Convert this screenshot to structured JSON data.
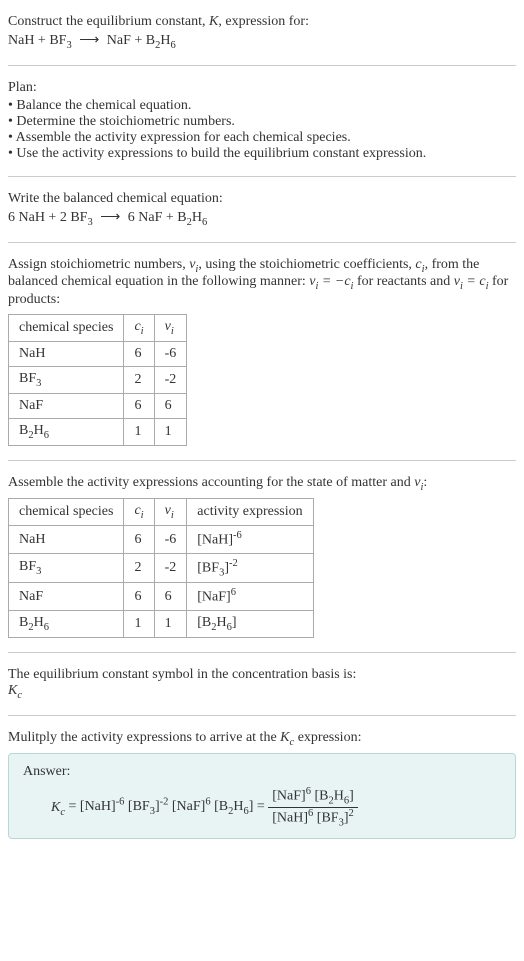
{
  "intro": {
    "line1": "Construct the equilibrium constant, ",
    "K": "K",
    "line1b": ", expression for:",
    "equation": "NaH + BF₃  ⟶  NaF + B₂H₆"
  },
  "plan": {
    "title": "Plan:",
    "items": [
      "• Balance the chemical equation.",
      "• Determine the stoichiometric numbers.",
      "• Assemble the activity expression for each chemical species.",
      "• Use the activity expressions to build the equilibrium constant expression."
    ]
  },
  "balanced": {
    "title": "Write the balanced chemical equation:",
    "equation": "6 NaH + 2 BF₃  ⟶  6 NaF + B₂H₆"
  },
  "stoich": {
    "text1": "Assign stoichiometric numbers, ",
    "nu_i": "νᵢ",
    "text2": ", using the stoichiometric coefficients, ",
    "c_i": "cᵢ",
    "text3": ", from the balanced chemical equation in the following manner: ",
    "eq1": "νᵢ = −cᵢ",
    "text4": " for reactants and ",
    "eq2": "νᵢ = cᵢ",
    "text5": " for products:",
    "headers": [
      "chemical species",
      "cᵢ",
      "νᵢ"
    ],
    "rows": [
      [
        "NaH",
        "6",
        "-6"
      ],
      [
        "BF₃",
        "2",
        "-2"
      ],
      [
        "NaF",
        "6",
        "6"
      ],
      [
        "B₂H₆",
        "1",
        "1"
      ]
    ]
  },
  "activity": {
    "text1": "Assemble the activity expressions accounting for the state of matter and ",
    "nu_i": "νᵢ",
    "text2": ":",
    "headers": [
      "chemical species",
      "cᵢ",
      "νᵢ",
      "activity expression"
    ],
    "rows": [
      [
        "NaH",
        "6",
        "-6",
        "[NaH]⁻⁶"
      ],
      [
        "BF₃",
        "2",
        "-2",
        "[BF₃]⁻²"
      ],
      [
        "NaF",
        "6",
        "6",
        "[NaF]⁶"
      ],
      [
        "B₂H₆",
        "1",
        "1",
        "[B₂H₆]"
      ]
    ]
  },
  "symbol": {
    "text": "The equilibrium constant symbol in the concentration basis is:",
    "kc": "K_c"
  },
  "multiply": {
    "text1": "Mulitply the activity expressions to arrive at the ",
    "kc": "K_c",
    "text2": " expression:"
  },
  "answer": {
    "label": "Answer:",
    "kc": "K_c",
    "lhs": " = [NaH]⁻⁶ [BF₃]⁻² [NaF]⁶ [B₂H₆] = ",
    "num": "[NaF]⁶ [B₂H₆]",
    "den": "[NaH]⁶ [BF₃]²"
  }
}
